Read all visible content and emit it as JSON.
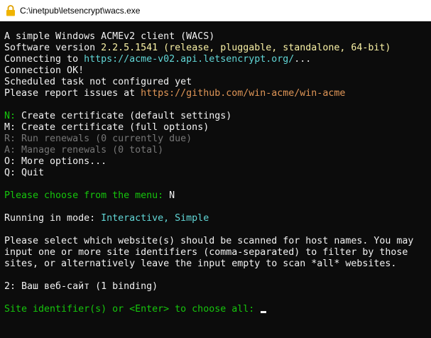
{
  "window": {
    "title": "C:\\inetpub\\letsencrypt\\wacs.exe",
    "icon": "lock-icon"
  },
  "console": {
    "header": {
      "line1": "A simple Windows ACMEv2 client (WACS)",
      "version_label": "Software version ",
      "version_value": "2.2.5.1541",
      "version_details": " (release, pluggable, standalone, 64-bit)",
      "connecting_label": "Connecting to ",
      "connecting_url": "https://acme-v02.api.letsencrypt.org/",
      "connecting_suffix": "...",
      "connection_ok": "Connection OK!",
      "scheduled_task": "Scheduled task not configured yet",
      "report_label": "Please report issues at ",
      "report_url": "https://github.com/win-acme/win-acme"
    },
    "menu": [
      {
        "key": "N:",
        "text": " Create certificate (default settings)",
        "disabled": false
      },
      {
        "key": "M:",
        "text": " Create certificate (full options)",
        "disabled": false
      },
      {
        "key": "R:",
        "text": " Run renewals (0 currently due)",
        "disabled": true
      },
      {
        "key": "A:",
        "text": " Manage renewals (0 total)",
        "disabled": true
      },
      {
        "key": "O:",
        "text": " More options...",
        "disabled": false
      },
      {
        "key": "Q:",
        "text": " Quit",
        "disabled": false
      }
    ],
    "choose_prompt": "Please choose from the menu: ",
    "choose_answer": "N",
    "mode_label": "Running in mode: ",
    "mode_value": "Interactive, Simple",
    "select_text": [
      "Please select which website(s) should be scanned for host names. You may",
      "input one or more site identifiers (comma-separated) to filter by those",
      "sites, or alternatively leave the input empty to scan *all* websites."
    ],
    "site_entry": "2: Ваш веб-сайт (1 binding)",
    "site_prompt": "Site identifier(s) or <Enter> to choose all: "
  },
  "colors": {
    "background": "#0c0c0c",
    "text": "#cccccc",
    "white": "#f2f2f2",
    "yellow": "#f9f1a5",
    "cyan": "#61d6d6",
    "green": "#13a10e",
    "bright_green": "#16c60c",
    "grey": "#767676",
    "orange": "#e09657"
  }
}
